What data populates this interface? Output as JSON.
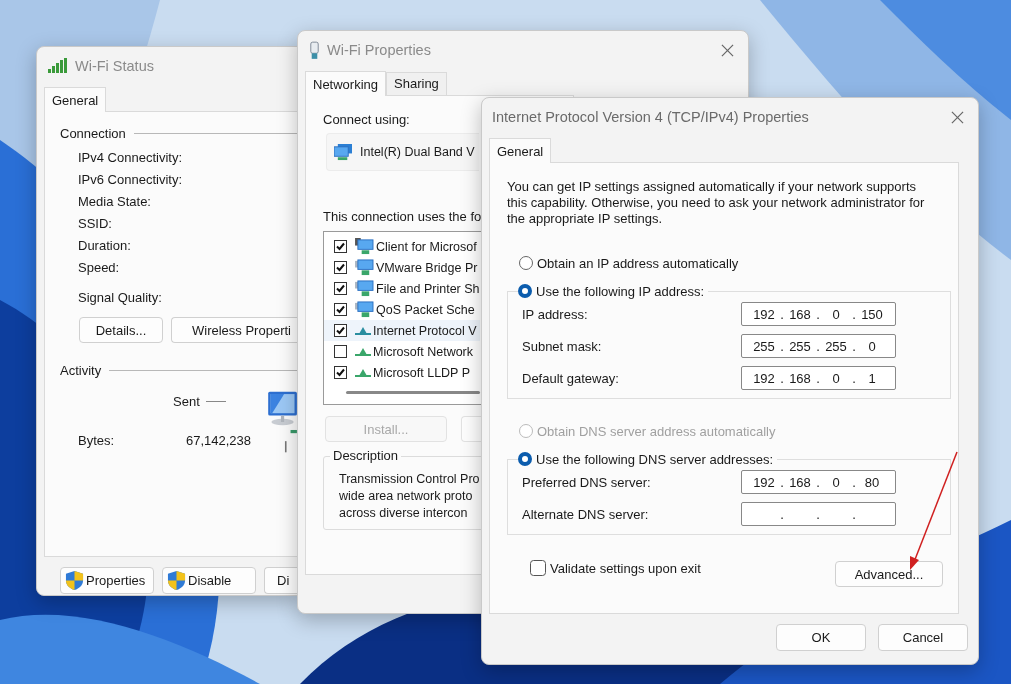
{
  "wifi_status": {
    "title": "Wi-Fi Status",
    "tabs": [
      {
        "label": "General",
        "selected": true
      }
    ],
    "connection_heading": "Connection",
    "connection_labels": [
      "IPv4 Connectivity:",
      "IPv6 Connectivity:",
      "Media State:",
      "SSID:",
      "Duration:",
      "Speed:"
    ],
    "signal_label": "Signal Quality:",
    "top_buttons": [
      "Details...",
      "Wireless Properti"
    ],
    "activity_heading": "Activity",
    "sent_label": "Sent",
    "bytes_label": "Bytes:",
    "bytes_sent": "67,142,238",
    "bottom_buttons": [
      {
        "label": "Properties",
        "shield": true
      },
      {
        "label": "Disable",
        "shield": true
      },
      {
        "label": "Di",
        "shield": false
      }
    ]
  },
  "wifi_properties": {
    "title": "Wi-Fi Properties",
    "tabs": [
      {
        "label": "Networking",
        "selected": true
      },
      {
        "label": "Sharing",
        "selected": false
      }
    ],
    "connect_using_label": "Connect using:",
    "adapter": "Intel(R) Dual Band V",
    "components_label": "This connection uses the fo",
    "components": [
      {
        "label": "Client for Microsof",
        "checked": true,
        "kind": "client",
        "selected": false
      },
      {
        "label": "VMware Bridge Pr",
        "checked": true,
        "kind": "service",
        "selected": false
      },
      {
        "label": "File and Printer Sh",
        "checked": true,
        "kind": "service",
        "selected": false
      },
      {
        "label": "QoS Packet Sche",
        "checked": true,
        "kind": "service",
        "selected": false
      },
      {
        "label": "Internet Protocol V",
        "checked": true,
        "kind": "protocol",
        "selected": true
      },
      {
        "label": "Microsoft Network",
        "checked": false,
        "kind": "protocol",
        "selected": false
      },
      {
        "label": "Microsoft LLDP P",
        "checked": true,
        "kind": "protocol",
        "selected": false
      }
    ],
    "install_button": {
      "label": "Install...",
      "disabled": true
    },
    "description_heading": "Description",
    "description_lines": [
      "Transmission Control Pro",
      "wide area network proto",
      "across diverse intercon"
    ]
  },
  "ipv4": {
    "title": "Internet Protocol Version 4 (TCP/IPv4) Properties",
    "tabs": [
      {
        "label": "General",
        "selected": true
      }
    ],
    "intro": "You can get IP settings assigned automatically if your network supports this capability. Otherwise, you need to ask your network administrator for the appropriate IP settings.",
    "separator": ".",
    "ip_options": [
      {
        "label": "Obtain an IP address automatically",
        "selected": false,
        "disabled": false
      },
      {
        "label": "Use the following IP address:",
        "selected": true,
        "disabled": false
      }
    ],
    "ip_fields": [
      {
        "label": "IP address:",
        "octets": [
          "192",
          "168",
          "0",
          "150"
        ]
      },
      {
        "label": "Subnet mask:",
        "octets": [
          "255",
          "255",
          "255",
          "0"
        ]
      },
      {
        "label": "Default gateway:",
        "octets": [
          "192",
          "168",
          "0",
          "1"
        ]
      }
    ],
    "dns_options": [
      {
        "label": "Obtain DNS server address automatically",
        "selected": false,
        "disabled": true
      },
      {
        "label": "Use the following DNS server addresses:",
        "selected": true,
        "disabled": false
      }
    ],
    "dns_fields": [
      {
        "label": "Preferred DNS server:",
        "octets": [
          "192",
          "168",
          "0",
          "80"
        ]
      },
      {
        "label": "Alternate DNS server:"
      }
    ],
    "validate": {
      "label": "Validate settings upon exit",
      "checked": false
    },
    "advanced_button": "Advanced...",
    "footer_buttons": [
      "OK",
      "Cancel"
    ]
  }
}
